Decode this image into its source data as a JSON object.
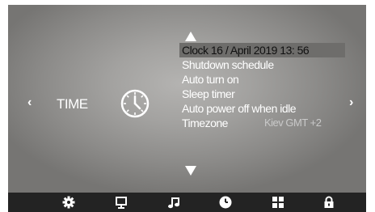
{
  "section": {
    "title": "TIME"
  },
  "navigation": {
    "prev_glyph": "‹",
    "next_glyph": "›"
  },
  "menu": {
    "items": [
      {
        "label": "Clock 16 / April 2019 13: 56",
        "selected": true
      },
      {
        "label": "Shutdown schedule"
      },
      {
        "label": "Auto turn on"
      },
      {
        "label": "Sleep timer"
      },
      {
        "label": "Auto power off when idle"
      },
      {
        "label": "Timezone",
        "value": "Kiev GMT +2"
      }
    ]
  },
  "tabbar": {
    "tabs": [
      {
        "icon": "gear-icon"
      },
      {
        "icon": "monitor-icon"
      },
      {
        "icon": "music-note-icon"
      },
      {
        "icon": "clock-icon",
        "active": true
      },
      {
        "icon": "grid-icon"
      },
      {
        "icon": "lock-icon"
      }
    ]
  },
  "colors": {
    "background_center": "#b4b3b1",
    "background_edge": "#767573",
    "selected_row": "#6e6d6b",
    "tabbar": "#232323",
    "text": "#ffffff",
    "value_text": "#c9c9c9"
  }
}
